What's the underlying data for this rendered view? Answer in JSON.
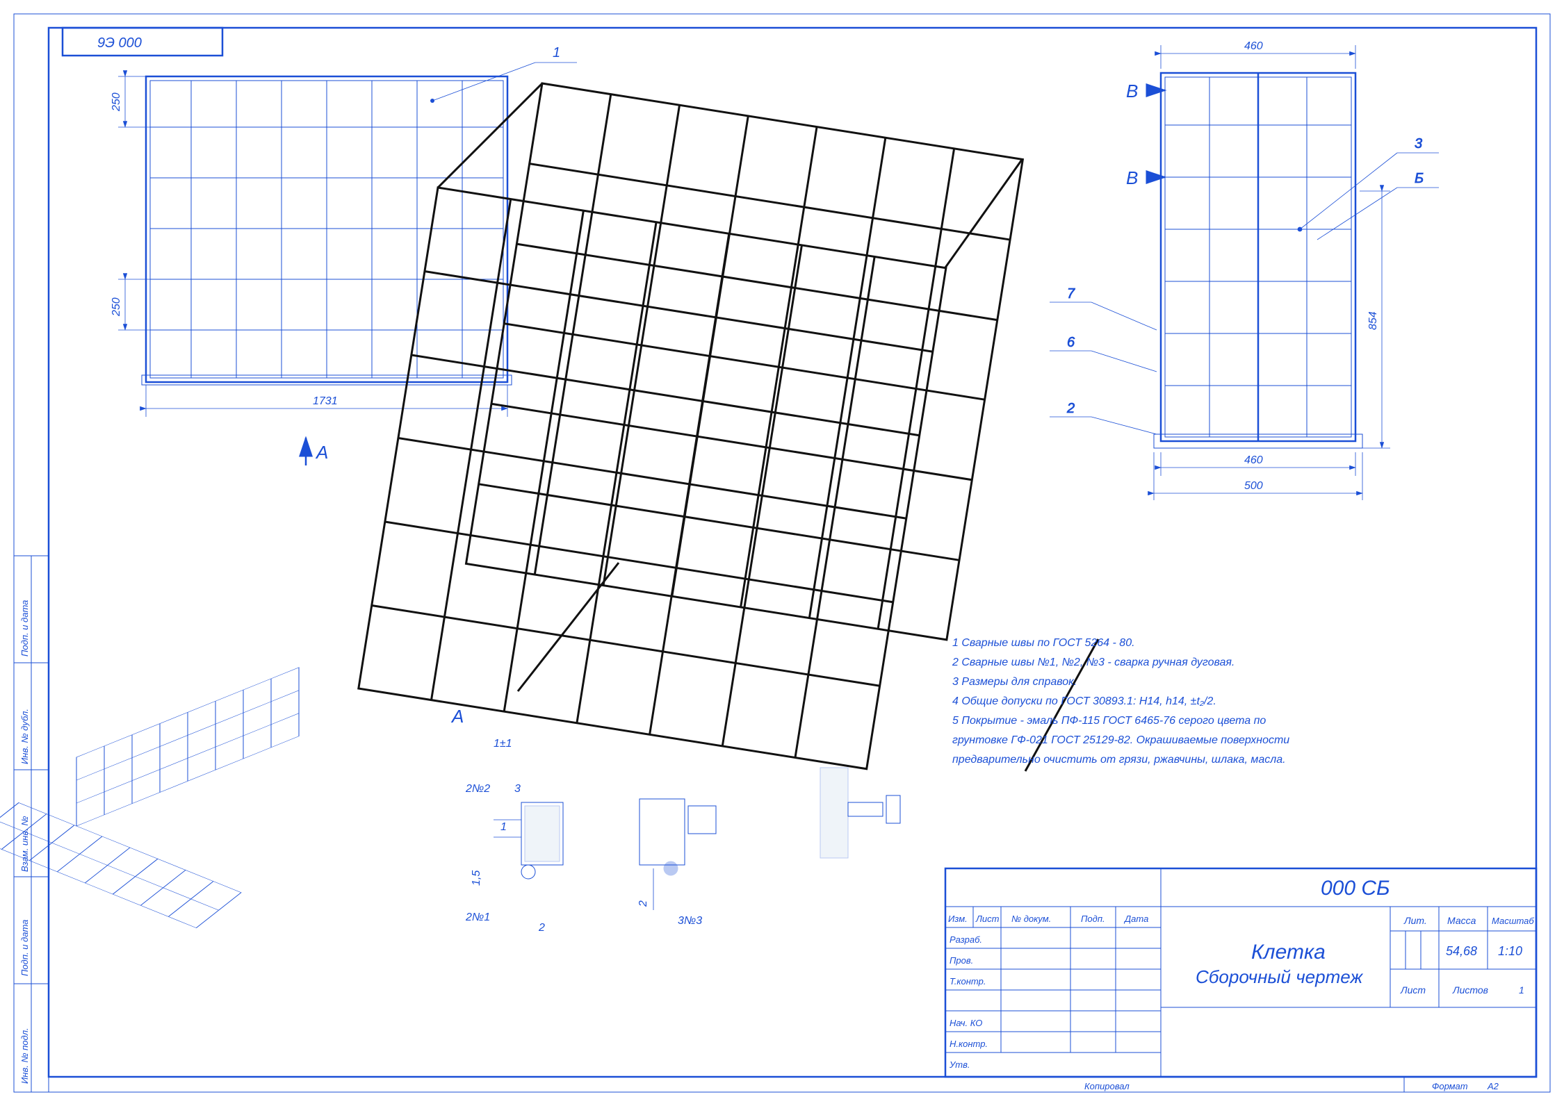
{
  "drawing_number": "9Э 000",
  "front_view": {
    "callout": "1",
    "dim_height_top": "250",
    "dim_height_mid": "250",
    "dim_width": "1731",
    "arrow_label": "А"
  },
  "side_view": {
    "dim_top": "460",
    "label_B1": "В",
    "label_B2": "В",
    "callout_3": "3",
    "callout_B_letter": "Б",
    "callout_7": "7",
    "callout_6": "6",
    "callout_2": "2",
    "dim_height": "854",
    "dim_inner_width": "460",
    "dim_outer_width": "500"
  },
  "details": {
    "A_label": "А",
    "tol_1_7": "1±1",
    "weld_2N2": "2№2",
    "weld_2N1": "2№1",
    "weld_3N3": "3№3",
    "dim_1": "1",
    "dim_1_5": "1,5",
    "dim_2a": "2",
    "dim_2b": "2",
    "dim_3": "3"
  },
  "notes": {
    "n1": "1 Сварные швы по ГОСТ 5264 - 80.",
    "n2": "2 Сварные швы №1, №2, №3 - сварка ручная дуговая.",
    "n3": "3 Размеры для справок.",
    "n4": "4 Общие допуски по ГОСТ 30893.1: H14, h14, ±t₂/2.",
    "n5a": "5 Покрытие - эмаль ПФ-115  ГОСТ 6465-76 серого цвета по",
    "n5b": "грунтовке ГФ-021 ГОСТ 25129-82. Окрашиваемые поверхности",
    "n5c": "предварительно очистить от грязи, ржавчины, шлака, масла."
  },
  "title_block": {
    "code": "000 СБ",
    "name1": "Клетка",
    "name2": "Сборочный чертеж",
    "header_Izm": "Изм.",
    "header_List": "Лист",
    "header_Ndoc": "№ докум.",
    "header_Podp": "Подп.",
    "header_Data": "Дата",
    "row_Razrab": "Разраб.",
    "row_Prov": "Пров.",
    "row_Tkontr": "Т.контр.",
    "row_NachKO": "Нач. КО",
    "row_Nkontr": "Н.контр.",
    "row_Utv": "Утв.",
    "Lit": "Лит.",
    "Massa": "Масса",
    "Mass_val": "54,68",
    "Masshtab": "Масштаб",
    "Scale_val": "1:10",
    "List_label": "Лист",
    "Listov_label": "Листов",
    "Listov_val": "1",
    "Kopiroval": "Копировал",
    "Format": "Формат",
    "Format_val": "А2"
  },
  "side_strip": {
    "r1": "Инв. № подл.",
    "r2": "Подп. и дата",
    "r3": "Взам. инв. №",
    "r4": "Инв. № дубл.",
    "r5": "Подп. и дата"
  }
}
